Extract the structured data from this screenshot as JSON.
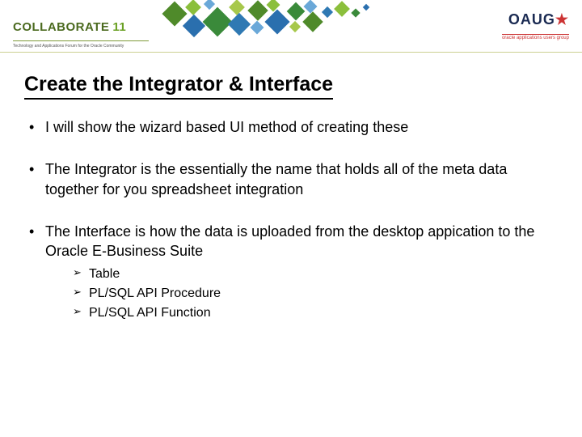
{
  "header": {
    "collab_word": "COLLABORATE",
    "collab_year": "11",
    "collab_tag": "Technology and Applications Forum for the Oracle Community",
    "oaug_main_pre": "OAUG",
    "oaug_star": "★",
    "oaug_sub": "oracle applications users group"
  },
  "title": "Create the Integrator & Interface",
  "bullets": [
    {
      "text": "I will show the wizard based UI method of creating these",
      "sub": []
    },
    {
      "text": "The Integrator is the essentially the name that holds all of the meta data together for you spreadsheet integration",
      "sub": []
    },
    {
      "text": "The Interface is how the data is uploaded from the desktop appication to the Oracle E-Business Suite",
      "sub": [
        "Table",
        "PL/SQL API Procedure",
        "PL/SQL API Function"
      ]
    }
  ],
  "pixel_squares": [
    {
      "l": 15,
      "t": 6,
      "s": 22,
      "c": "#4f8a2a"
    },
    {
      "l": 42,
      "t": 2,
      "s": 14,
      "c": "#8bbf3c"
    },
    {
      "l": 40,
      "t": 22,
      "s": 20,
      "c": "#2a6fae"
    },
    {
      "l": 64,
      "t": 0,
      "s": 10,
      "c": "#6aa8d8"
    },
    {
      "l": 66,
      "t": 14,
      "s": 26,
      "c": "#3a8a3a"
    },
    {
      "l": 96,
      "t": 2,
      "s": 14,
      "c": "#a7c84b"
    },
    {
      "l": 96,
      "t": 20,
      "s": 20,
      "c": "#2f79b3"
    },
    {
      "l": 120,
      "t": 4,
      "s": 18,
      "c": "#4f8a2a"
    },
    {
      "l": 122,
      "t": 28,
      "s": 12,
      "c": "#6aa8d8"
    },
    {
      "l": 142,
      "t": 0,
      "s": 12,
      "c": "#8bbf3c"
    },
    {
      "l": 142,
      "t": 16,
      "s": 22,
      "c": "#2a6fae"
    },
    {
      "l": 168,
      "t": 6,
      "s": 16,
      "c": "#3a8a3a"
    },
    {
      "l": 170,
      "t": 28,
      "s": 10,
      "c": "#a7c84b"
    },
    {
      "l": 188,
      "t": 2,
      "s": 12,
      "c": "#6aa8d8"
    },
    {
      "l": 188,
      "t": 18,
      "s": 18,
      "c": "#4f8a2a"
    },
    {
      "l": 210,
      "t": 10,
      "s": 10,
      "c": "#2f79b3"
    },
    {
      "l": 226,
      "t": 4,
      "s": 14,
      "c": "#8bbf3c"
    },
    {
      "l": 246,
      "t": 12,
      "s": 8,
      "c": "#3a8a3a"
    },
    {
      "l": 260,
      "t": 6,
      "s": 6,
      "c": "#2a6fae"
    }
  ]
}
